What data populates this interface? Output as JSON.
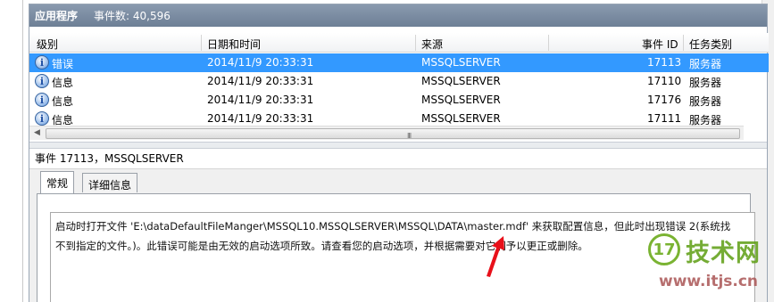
{
  "app": {
    "title": "应用程序",
    "event_count_label": "事件数: 40,596"
  },
  "columns": [
    "级别",
    "日期和时间",
    "来源",
    "事件 ID",
    "任务类别"
  ],
  "rows": [
    {
      "icon": "info-icon",
      "level": "错误",
      "datetime": "2014/11/9 20:33:31",
      "source": "MSSQLSERVER",
      "event_id": "17113",
      "category": "服务器",
      "selected": true
    },
    {
      "icon": "info-icon",
      "level": "信息",
      "datetime": "2014/11/9 20:33:31",
      "source": "MSSQLSERVER",
      "event_id": "17110",
      "category": "服务器",
      "selected": false
    },
    {
      "icon": "info-icon",
      "level": "信息",
      "datetime": "2014/11/9 20:33:31",
      "source": "MSSQLSERVER",
      "event_id": "17176",
      "category": "服务器",
      "selected": false
    },
    {
      "icon": "info-icon",
      "level": "信息",
      "datetime": "2014/11/9 20:33:31",
      "source": "MSSQLSERVER",
      "event_id": "17111",
      "category": "服务器",
      "selected": false
    }
  ],
  "hscroll_grip": "III",
  "event_header": "事件 17113，MSSQLSERVER",
  "tabs": [
    {
      "label": "常规",
      "active": true
    },
    {
      "label": "详细信息",
      "active": false
    }
  ],
  "message_line1": "启动时打开文件 'E:\\dataDefaultFileManger\\MSSQL10.MSSQLSERVER\\MSSQL\\DATA\\master.mdf' 来获取配置信息，但此时出现错误 2(系统找",
  "message_line2": "不到指定的文件。)。此错误可能是由无效的启动选项所致。请查看您的启动选项，并根据需要对它们予以更正或删除。",
  "watermark": {
    "logo_text": "17",
    "name": "技术网",
    "url": "www.itjs.cn"
  },
  "colors": {
    "selection": "#3399ff",
    "titlebar": "#7a8ba3",
    "annotation_arrow": "#e8101a",
    "watermark_green": "#5d9e12"
  }
}
